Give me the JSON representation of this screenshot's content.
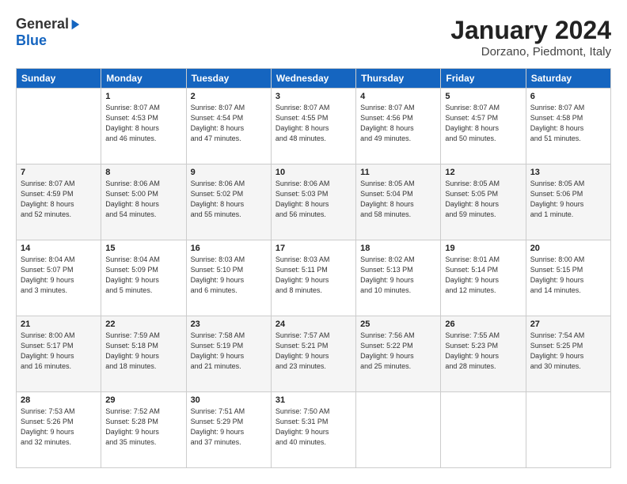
{
  "header": {
    "logo_general": "General",
    "logo_blue": "Blue",
    "title": "January 2024",
    "subtitle": "Dorzano, Piedmont, Italy"
  },
  "days_of_week": [
    "Sunday",
    "Monday",
    "Tuesday",
    "Wednesday",
    "Thursday",
    "Friday",
    "Saturday"
  ],
  "weeks": [
    [
      {
        "day": "",
        "info": ""
      },
      {
        "day": "1",
        "info": "Sunrise: 8:07 AM\nSunset: 4:53 PM\nDaylight: 8 hours\nand 46 minutes."
      },
      {
        "day": "2",
        "info": "Sunrise: 8:07 AM\nSunset: 4:54 PM\nDaylight: 8 hours\nand 47 minutes."
      },
      {
        "day": "3",
        "info": "Sunrise: 8:07 AM\nSunset: 4:55 PM\nDaylight: 8 hours\nand 48 minutes."
      },
      {
        "day": "4",
        "info": "Sunrise: 8:07 AM\nSunset: 4:56 PM\nDaylight: 8 hours\nand 49 minutes."
      },
      {
        "day": "5",
        "info": "Sunrise: 8:07 AM\nSunset: 4:57 PM\nDaylight: 8 hours\nand 50 minutes."
      },
      {
        "day": "6",
        "info": "Sunrise: 8:07 AM\nSunset: 4:58 PM\nDaylight: 8 hours\nand 51 minutes."
      }
    ],
    [
      {
        "day": "7",
        "info": "Sunrise: 8:07 AM\nSunset: 4:59 PM\nDaylight: 8 hours\nand 52 minutes."
      },
      {
        "day": "8",
        "info": "Sunrise: 8:06 AM\nSunset: 5:00 PM\nDaylight: 8 hours\nand 54 minutes."
      },
      {
        "day": "9",
        "info": "Sunrise: 8:06 AM\nSunset: 5:02 PM\nDaylight: 8 hours\nand 55 minutes."
      },
      {
        "day": "10",
        "info": "Sunrise: 8:06 AM\nSunset: 5:03 PM\nDaylight: 8 hours\nand 56 minutes."
      },
      {
        "day": "11",
        "info": "Sunrise: 8:05 AM\nSunset: 5:04 PM\nDaylight: 8 hours\nand 58 minutes."
      },
      {
        "day": "12",
        "info": "Sunrise: 8:05 AM\nSunset: 5:05 PM\nDaylight: 8 hours\nand 59 minutes."
      },
      {
        "day": "13",
        "info": "Sunrise: 8:05 AM\nSunset: 5:06 PM\nDaylight: 9 hours\nand 1 minute."
      }
    ],
    [
      {
        "day": "14",
        "info": "Sunrise: 8:04 AM\nSunset: 5:07 PM\nDaylight: 9 hours\nand 3 minutes."
      },
      {
        "day": "15",
        "info": "Sunrise: 8:04 AM\nSunset: 5:09 PM\nDaylight: 9 hours\nand 5 minutes."
      },
      {
        "day": "16",
        "info": "Sunrise: 8:03 AM\nSunset: 5:10 PM\nDaylight: 9 hours\nand 6 minutes."
      },
      {
        "day": "17",
        "info": "Sunrise: 8:03 AM\nSunset: 5:11 PM\nDaylight: 9 hours\nand 8 minutes."
      },
      {
        "day": "18",
        "info": "Sunrise: 8:02 AM\nSunset: 5:13 PM\nDaylight: 9 hours\nand 10 minutes."
      },
      {
        "day": "19",
        "info": "Sunrise: 8:01 AM\nSunset: 5:14 PM\nDaylight: 9 hours\nand 12 minutes."
      },
      {
        "day": "20",
        "info": "Sunrise: 8:00 AM\nSunset: 5:15 PM\nDaylight: 9 hours\nand 14 minutes."
      }
    ],
    [
      {
        "day": "21",
        "info": "Sunrise: 8:00 AM\nSunset: 5:17 PM\nDaylight: 9 hours\nand 16 minutes."
      },
      {
        "day": "22",
        "info": "Sunrise: 7:59 AM\nSunset: 5:18 PM\nDaylight: 9 hours\nand 18 minutes."
      },
      {
        "day": "23",
        "info": "Sunrise: 7:58 AM\nSunset: 5:19 PM\nDaylight: 9 hours\nand 21 minutes."
      },
      {
        "day": "24",
        "info": "Sunrise: 7:57 AM\nSunset: 5:21 PM\nDaylight: 9 hours\nand 23 minutes."
      },
      {
        "day": "25",
        "info": "Sunrise: 7:56 AM\nSunset: 5:22 PM\nDaylight: 9 hours\nand 25 minutes."
      },
      {
        "day": "26",
        "info": "Sunrise: 7:55 AM\nSunset: 5:23 PM\nDaylight: 9 hours\nand 28 minutes."
      },
      {
        "day": "27",
        "info": "Sunrise: 7:54 AM\nSunset: 5:25 PM\nDaylight: 9 hours\nand 30 minutes."
      }
    ],
    [
      {
        "day": "28",
        "info": "Sunrise: 7:53 AM\nSunset: 5:26 PM\nDaylight: 9 hours\nand 32 minutes."
      },
      {
        "day": "29",
        "info": "Sunrise: 7:52 AM\nSunset: 5:28 PM\nDaylight: 9 hours\nand 35 minutes."
      },
      {
        "day": "30",
        "info": "Sunrise: 7:51 AM\nSunset: 5:29 PM\nDaylight: 9 hours\nand 37 minutes."
      },
      {
        "day": "31",
        "info": "Sunrise: 7:50 AM\nSunset: 5:31 PM\nDaylight: 9 hours\nand 40 minutes."
      },
      {
        "day": "",
        "info": ""
      },
      {
        "day": "",
        "info": ""
      },
      {
        "day": "",
        "info": ""
      }
    ]
  ]
}
